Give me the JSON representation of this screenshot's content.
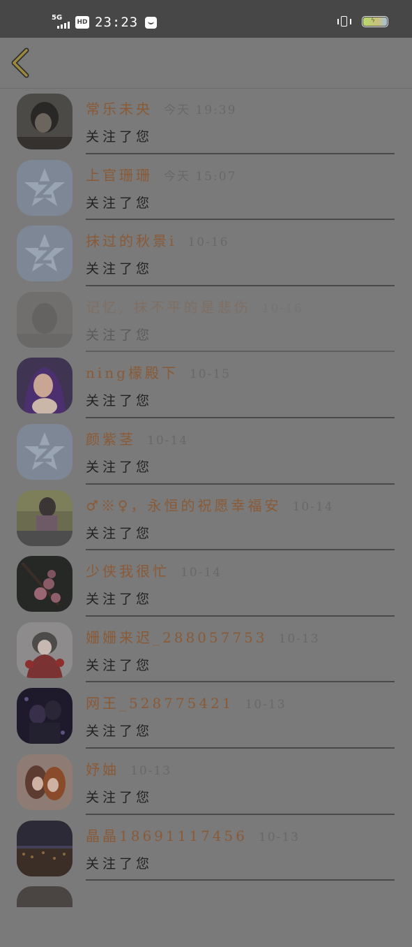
{
  "status_bar": {
    "network": "5G",
    "hd": "HD",
    "time": "23:23"
  },
  "header": {
    "back_icon": "chevron-left-icon"
  },
  "items": [
    {
      "name": "常乐未央",
      "time": "今天 19:39",
      "action": "关注了您",
      "avatar": "photo-dark"
    },
    {
      "name": "上官珊珊",
      "time": "今天 15:07",
      "action": "关注了您",
      "avatar": "qq-default"
    },
    {
      "name": "抹过的秋景i",
      "time": "10-16",
      "action": "关注了您",
      "avatar": "qq-default"
    },
    {
      "name": "记忆, 抹不平的是悲伤",
      "time": "10-16",
      "action": "关注了您",
      "avatar": "photo-faded",
      "faded": true
    },
    {
      "name": "ning檬殿下",
      "time": "10-15",
      "action": "关注了您",
      "avatar": "anime-purple"
    },
    {
      "name": "颜紫茎",
      "time": "10-14",
      "action": "关注了您",
      "avatar": "qq-default"
    },
    {
      "name": "♂※♀，永恒的祝愿幸福安",
      "time": "10-14",
      "action": "关注了您",
      "avatar": "photo-girl"
    },
    {
      "name": "少侠我很忙",
      "time": "10-14",
      "action": "关注了您",
      "avatar": "blossom"
    },
    {
      "name": "姗姗来迟_288057753",
      "time": "10-13",
      "action": "关注了您",
      "avatar": "anime-red"
    },
    {
      "name": "网王_528775421",
      "time": "10-13",
      "action": "关注了您",
      "avatar": "anime-dark"
    },
    {
      "name": "妤妯",
      "time": "10-13",
      "action": "关注了您",
      "avatar": "anime-orange"
    },
    {
      "name": "晶晶18691117456",
      "time": "10-13",
      "action": "关注了您",
      "avatar": "city-night"
    }
  ]
}
